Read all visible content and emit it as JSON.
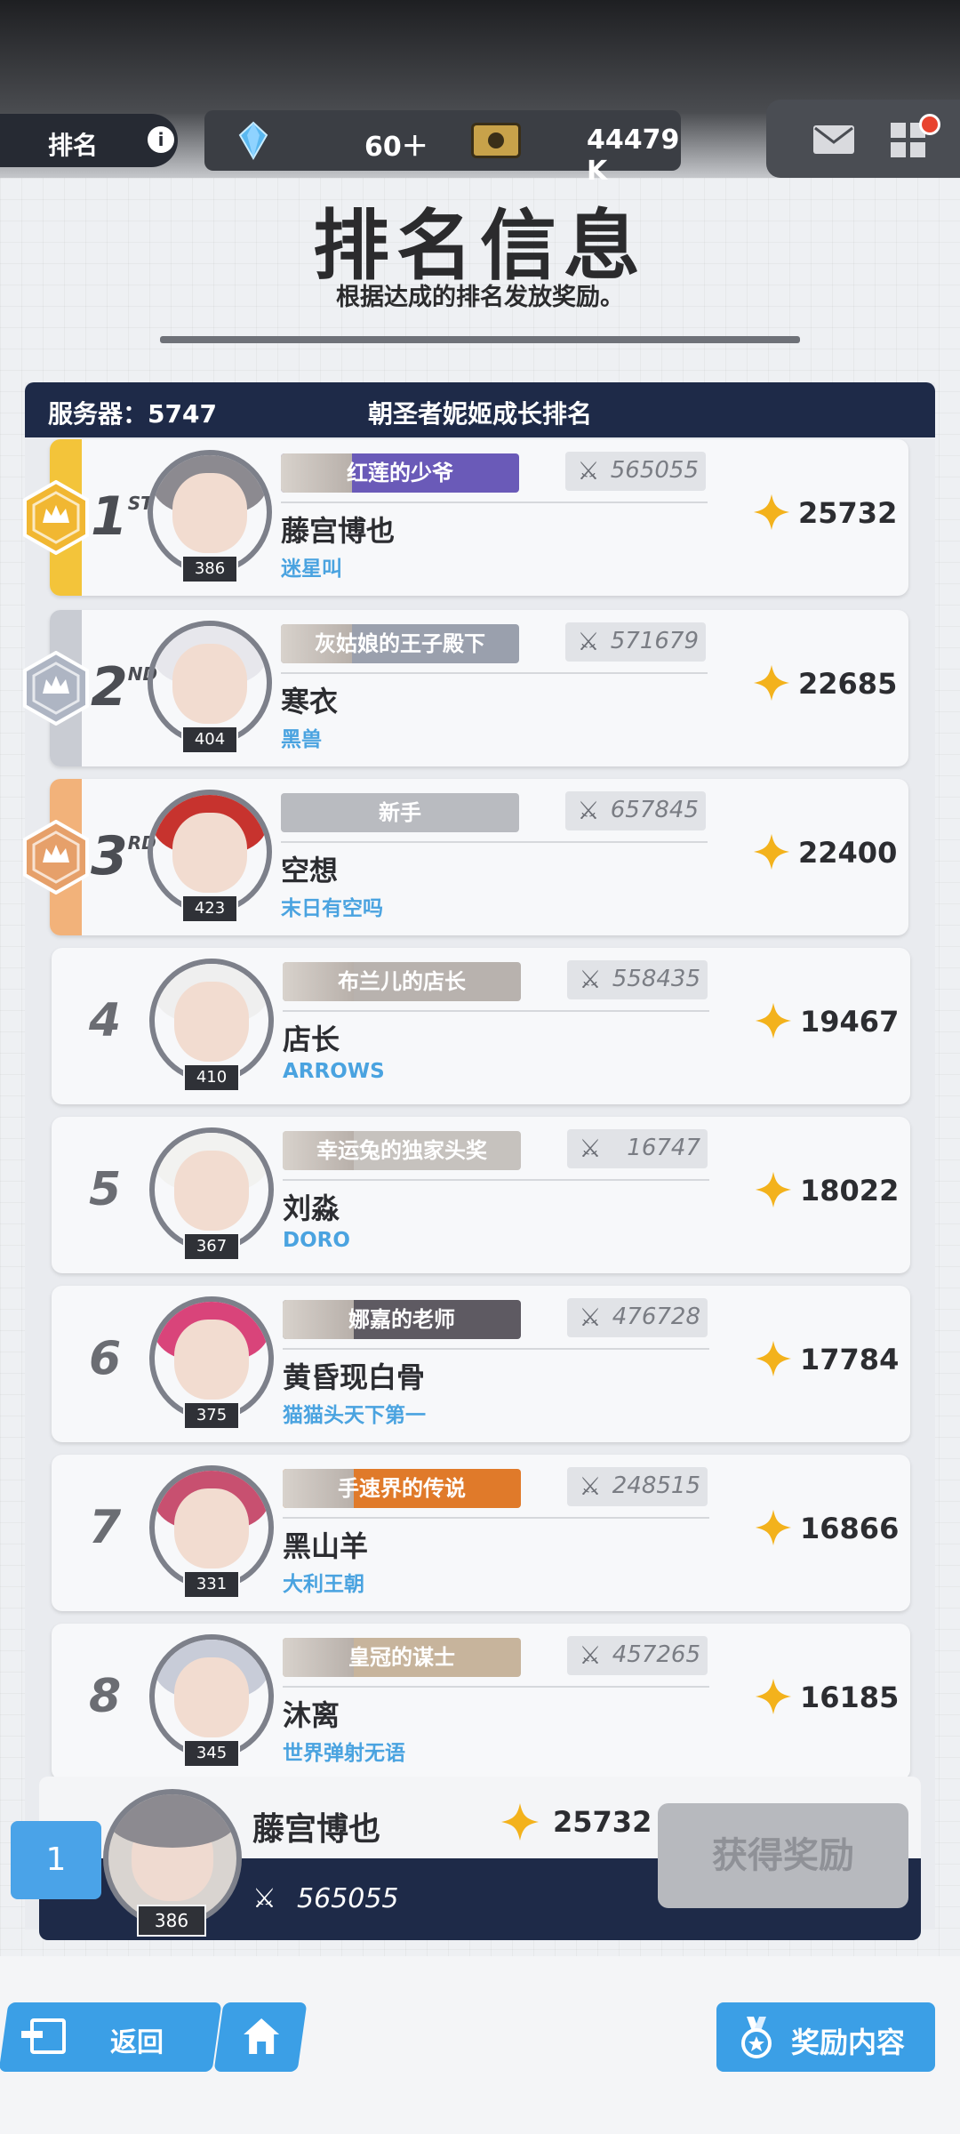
{
  "header": {
    "rank_tab_label": "排名",
    "info_glyph": "i",
    "resource1_value": "60＋",
    "resource2_value": "44479 K",
    "colors": {
      "dark_bar": "#3b3e44",
      "accent_blue": "#3b9fe6",
      "notification": "#e8442f"
    }
  },
  "page": {
    "title": "排名信息",
    "subtitle": "根据达成的排名发放奖励。"
  },
  "board": {
    "server_label": "服务器：5747",
    "title": "朝圣者妮姬成长排名",
    "rows": [
      {
        "rank": "1",
        "suffix": "ST",
        "banner": "红莲的少爷",
        "power": "565055",
        "name": "藤宫博也",
        "guild": "迷星叫",
        "score": "25732",
        "level": "386",
        "medal": "gold"
      },
      {
        "rank": "2",
        "suffix": "ND",
        "banner": "灰姑娘的王子殿下",
        "power": "571679",
        "name": "寒衣",
        "guild": "黑兽",
        "score": "22685",
        "level": "404",
        "medal": "silver"
      },
      {
        "rank": "3",
        "suffix": "RD",
        "banner": "新手",
        "power": "657845",
        "name": "空想",
        "guild": "末日有空吗",
        "score": "22400",
        "level": "423",
        "medal": "bronze"
      },
      {
        "rank": "4",
        "suffix": "",
        "banner": "布兰儿的店长",
        "power": "558435",
        "name": "店长",
        "guild": "ARROWS",
        "score": "19467",
        "level": "410",
        "medal": ""
      },
      {
        "rank": "5",
        "suffix": "",
        "banner": "幸运兔的独家头奖",
        "power": "16747",
        "name": "刘淼",
        "guild": "DORO",
        "score": "18022",
        "level": "367",
        "medal": ""
      },
      {
        "rank": "6",
        "suffix": "",
        "banner": "娜嘉的老师",
        "power": "476728",
        "name": "黄昏现白骨",
        "guild": "猫猫头天下第一",
        "score": "17784",
        "level": "375",
        "medal": ""
      },
      {
        "rank": "7",
        "suffix": "",
        "banner": "手速界的传说",
        "power": "248515",
        "name": "黑山羊",
        "guild": "大利王朝",
        "score": "16866",
        "level": "331",
        "medal": ""
      },
      {
        "rank": "8",
        "suffix": "",
        "banner": "皇冠的谋士",
        "power": "457265",
        "name": "沐离",
        "guild": "世界弹射无语",
        "score": "16185",
        "level": "345",
        "medal": ""
      }
    ]
  },
  "my_rank": {
    "rank": "1",
    "name": "藤宫博也",
    "score": "25732",
    "power": "565055",
    "level": "386",
    "claim_label": "获得奖励"
  },
  "footer": {
    "back_label": "返回",
    "rewards_label": "奖励内容"
  },
  "icons": [
    "gem-icon",
    "ticket-icon",
    "mail-icon",
    "menu-icon",
    "sword-icon",
    "star-icon",
    "back-icon",
    "home-icon",
    "medal-icon"
  ]
}
